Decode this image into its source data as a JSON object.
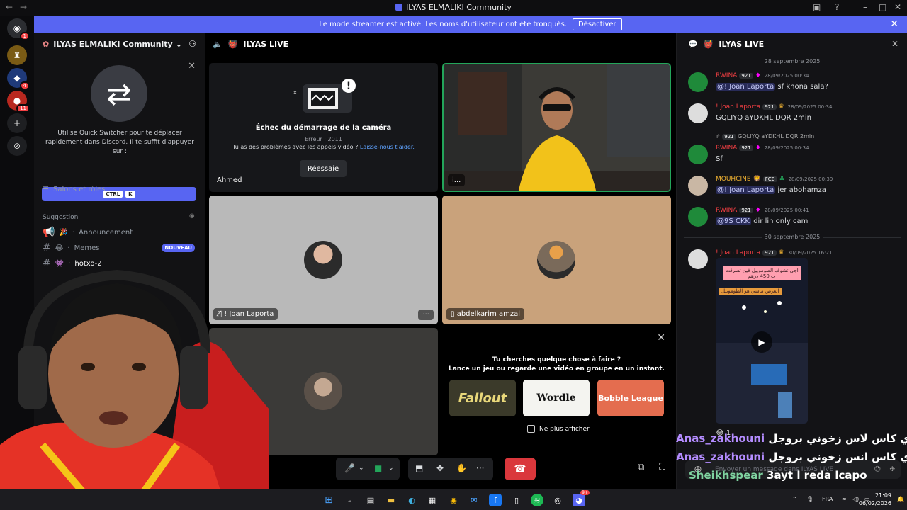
{
  "window": {
    "title": "ILYAS ELMALIKI Community"
  },
  "banner": {
    "text": "Le mode streamer est activé. Les noms d'utilisateur ont été tronqués.",
    "button": "Désactiver"
  },
  "rail": {
    "badges": [
      "1",
      "4",
      "11"
    ]
  },
  "sidebar": {
    "server_name": "ILYAS ELMALIKI Community",
    "quick_switcher": {
      "text": "Utilise Quick Switcher pour te déplacer rapidement dans Discord. Il te suffit d'appuyer sur :",
      "key1": "CTRL",
      "key2": "K"
    },
    "salons_roles": "Salons et rôles",
    "suggestion_label": "Suggestion",
    "channels": [
      {
        "name": "Announcement"
      },
      {
        "name": "Memes",
        "badge": "NOUVEAU"
      },
      {
        "name": "hotxo-2"
      }
    ]
  },
  "voice": {
    "channel_name": "ILYAS LIVE",
    "tiles": {
      "camera_fail": {
        "title": "Échec du démarrage de la caméra",
        "error": "Erreur : 2011",
        "question": "Tu as des problèmes avec les appels vidéo ?",
        "link": "Laisse-nous t'aider.",
        "retry": "Réessaie",
        "user": "Ahmed"
      },
      "live_user": "i...",
      "joan": "! Joan Laporta",
      "joan_more": "···",
      "abdelkarim": "abdelkarim amzal"
    },
    "activity": {
      "line1": "Tu cherches quelque chose à faire ?",
      "line2": "Lance un jeu ou regarde une vidéo en groupe en un instant.",
      "games": [
        "Fallout",
        "Wordle",
        "Bobble League"
      ],
      "checkbox": "Ne plus afficher"
    }
  },
  "chat": {
    "title": "ILYAS LIVE",
    "date1": "28 septembre 2025",
    "date2": "30 septembre 2025",
    "messages": [
      {
        "user": "RWINA",
        "tag": "921",
        "time": "28/09/2025 00:34",
        "mention": "@! Joan Laporta",
        "text": "sf khona sala?"
      },
      {
        "user": "! Joan Laporta",
        "tag": "921",
        "time": "28/09/2025 00:34",
        "mention": "",
        "text": "GQLIYQ aYDKHL DQR 2min"
      },
      {
        "user": "RWINA",
        "tag": "921",
        "time": "28/09/2025 00:34",
        "mention": "",
        "text": "Sf"
      },
      {
        "user": "MOUHCINE",
        "tag": "FCB",
        "time": "28/09/2025 00:39",
        "mention": "@! Joan Laporta",
        "text": "jer abohamza"
      },
      {
        "user": "RWINA",
        "tag": "921",
        "time": "28/09/2025 00:41",
        "mention": "@9S CKK",
        "text": "dir lih only cam"
      },
      {
        "user": "! Joan Laporta",
        "tag": "921",
        "time": "30/09/2025 16:21",
        "mention": "",
        "text": ""
      }
    ],
    "reply_preview": "GQLIYQ aYDKHL DQR 2min",
    "reply_tag": "921",
    "video_caption1": "اجي تشوف الطوموبيل فين تسرقت ب 450 درهم",
    "video_caption2": "العرض ماشي هو الطوموبيل",
    "reaction_count": "1",
    "input_placeholder": "Envoyer un message dans ILYAS LIVE"
  },
  "overlay_chat": [
    {
      "user": "Anas_zakhouni",
      "text": "شي ديدي كاس لاس زخوني بروجل"
    },
    {
      "user": "Anas_zakhouni",
      "text": "شي ديدي كاس انس زخوني بروجل"
    },
    {
      "user": "Sheikhspear",
      "text": "3ayt l reda lcapo"
    }
  ],
  "taskbar": {
    "language": "FRA",
    "time": "21:09",
    "date": "06/02/2026",
    "notif": "9+"
  }
}
